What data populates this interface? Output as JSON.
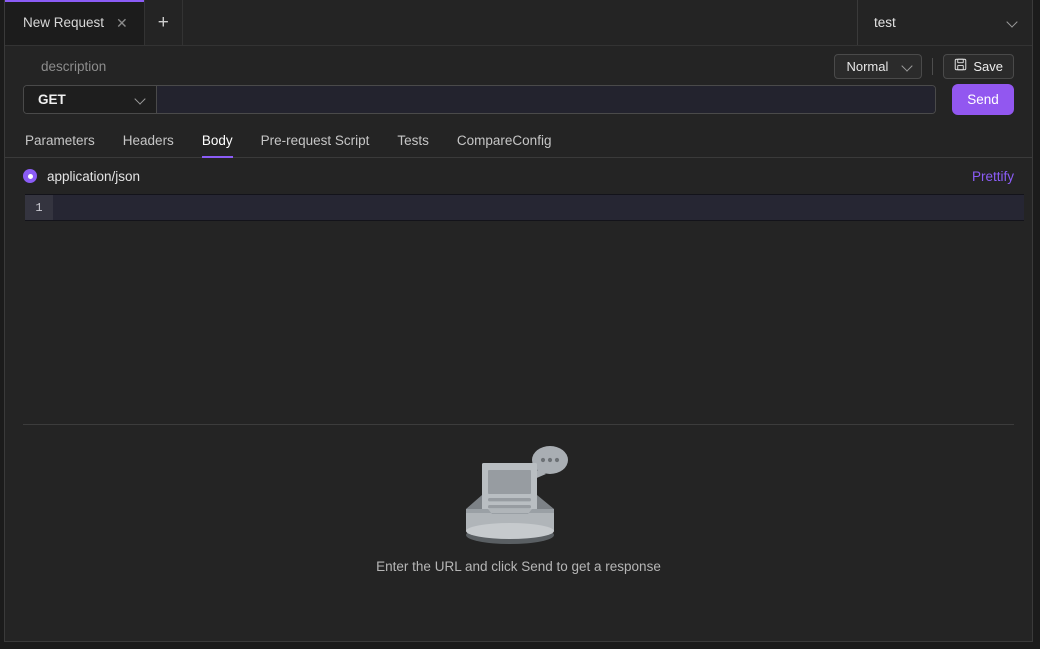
{
  "window": {
    "tabs": [
      {
        "label": "New Request",
        "close_icon": "close-icon",
        "active": true
      }
    ],
    "new_tab_icon": "plus-icon",
    "environment": {
      "value": "test",
      "chevron_icon": "chevron-down-icon"
    }
  },
  "request": {
    "description": {
      "value": "",
      "placeholder": "description"
    },
    "mode": {
      "value": "Normal",
      "chevron_icon": "chevron-down-icon"
    },
    "save": {
      "label": "Save",
      "icon": "save-disk-icon"
    },
    "method": {
      "value": "GET",
      "chevron_icon": "chevron-down-icon"
    },
    "url": {
      "value": "",
      "placeholder": ""
    },
    "send_label": "Send"
  },
  "section_tabs": [
    {
      "label": "Parameters",
      "active": false
    },
    {
      "label": "Headers",
      "active": false
    },
    {
      "label": "Body",
      "active": true
    },
    {
      "label": "Pre-request Script",
      "active": false
    },
    {
      "label": "Tests",
      "active": false
    },
    {
      "label": "CompareConfig",
      "active": false
    }
  ],
  "body": {
    "content_type": "application/json",
    "radio_icon": "radio-selected-icon",
    "prettify_label": "Prettify",
    "editor": {
      "line_numbers": [
        "1"
      ],
      "lines": [
        ""
      ]
    }
  },
  "response": {
    "empty_illustration": "inbox-tray-message-illustration",
    "empty_message": "Enter the URL and click Send to get a response"
  },
  "colors": {
    "accent": "#8b5cf6",
    "send_button": "#9257f0",
    "window_bg": "#242424",
    "tab_bg": "#1c1c1c",
    "editor_bg": "#262633",
    "text_primary": "#e4e4e4",
    "text_muted": "#8d8d8d"
  }
}
